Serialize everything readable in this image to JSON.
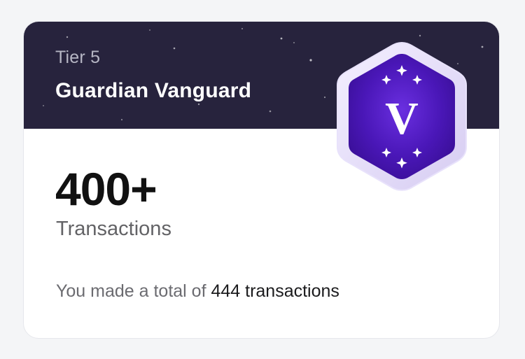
{
  "tier": {
    "level_label": "Tier 5",
    "name": "Guardian Vanguard",
    "badge_letter": "V"
  },
  "stat": {
    "value": "400+",
    "label": "Transactions"
  },
  "summary": {
    "prefix": "You made a total of ",
    "highlight": "444 transactions"
  },
  "colors": {
    "header_bg": "#27233d",
    "badge_purple": "#4a17b8",
    "card_bg": "#ffffff",
    "page_bg": "#f4f5f7"
  },
  "icons": {
    "badge": "hexagon-shield-icon",
    "sparkle": "sparkle-star-icon"
  }
}
